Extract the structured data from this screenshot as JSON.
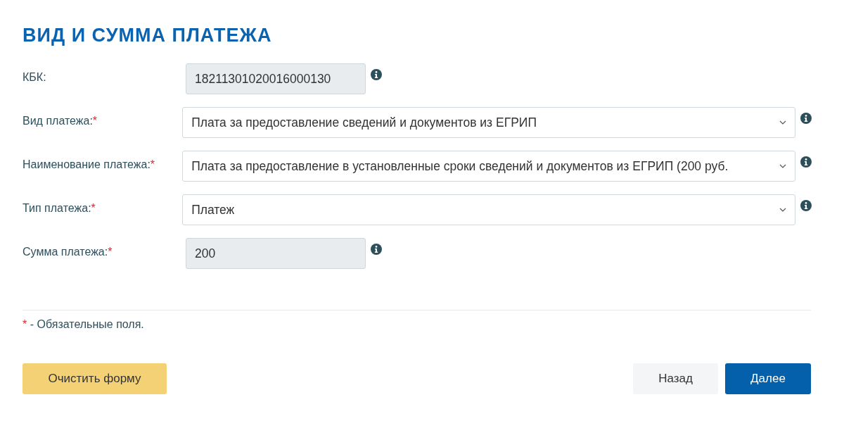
{
  "title": "ВИД И СУММА ПЛАТЕЖА",
  "fields": [
    {
      "label": "КБК:",
      "kind": "readonly",
      "value": "18211301020016000130"
    },
    {
      "label": "Вид платежа:",
      "required_mark": "*",
      "kind": "select",
      "value": "Плата за предоставление сведений и документов из ЕГРИП"
    },
    {
      "label": "Наименование платежа:",
      "required_mark": "*",
      "kind": "select",
      "value": "Плата за предоставление в установленные сроки сведений и документов из ЕГРИП (200 руб."
    },
    {
      "label": "Тип платежа:",
      "required_mark": "*",
      "kind": "select",
      "value": "Платеж"
    },
    {
      "label": "Сумма платежа:",
      "required_mark": "*",
      "kind": "readonly",
      "value": "200"
    }
  ],
  "note": {
    "mark": "*",
    "text": "- Обязательные поля."
  },
  "buttons": [
    {
      "label": "Очистить форму",
      "kind": "warning"
    },
    {
      "label": "Назад",
      "kind": "secondary"
    },
    {
      "label": "Далее",
      "kind": "primary"
    }
  ]
}
